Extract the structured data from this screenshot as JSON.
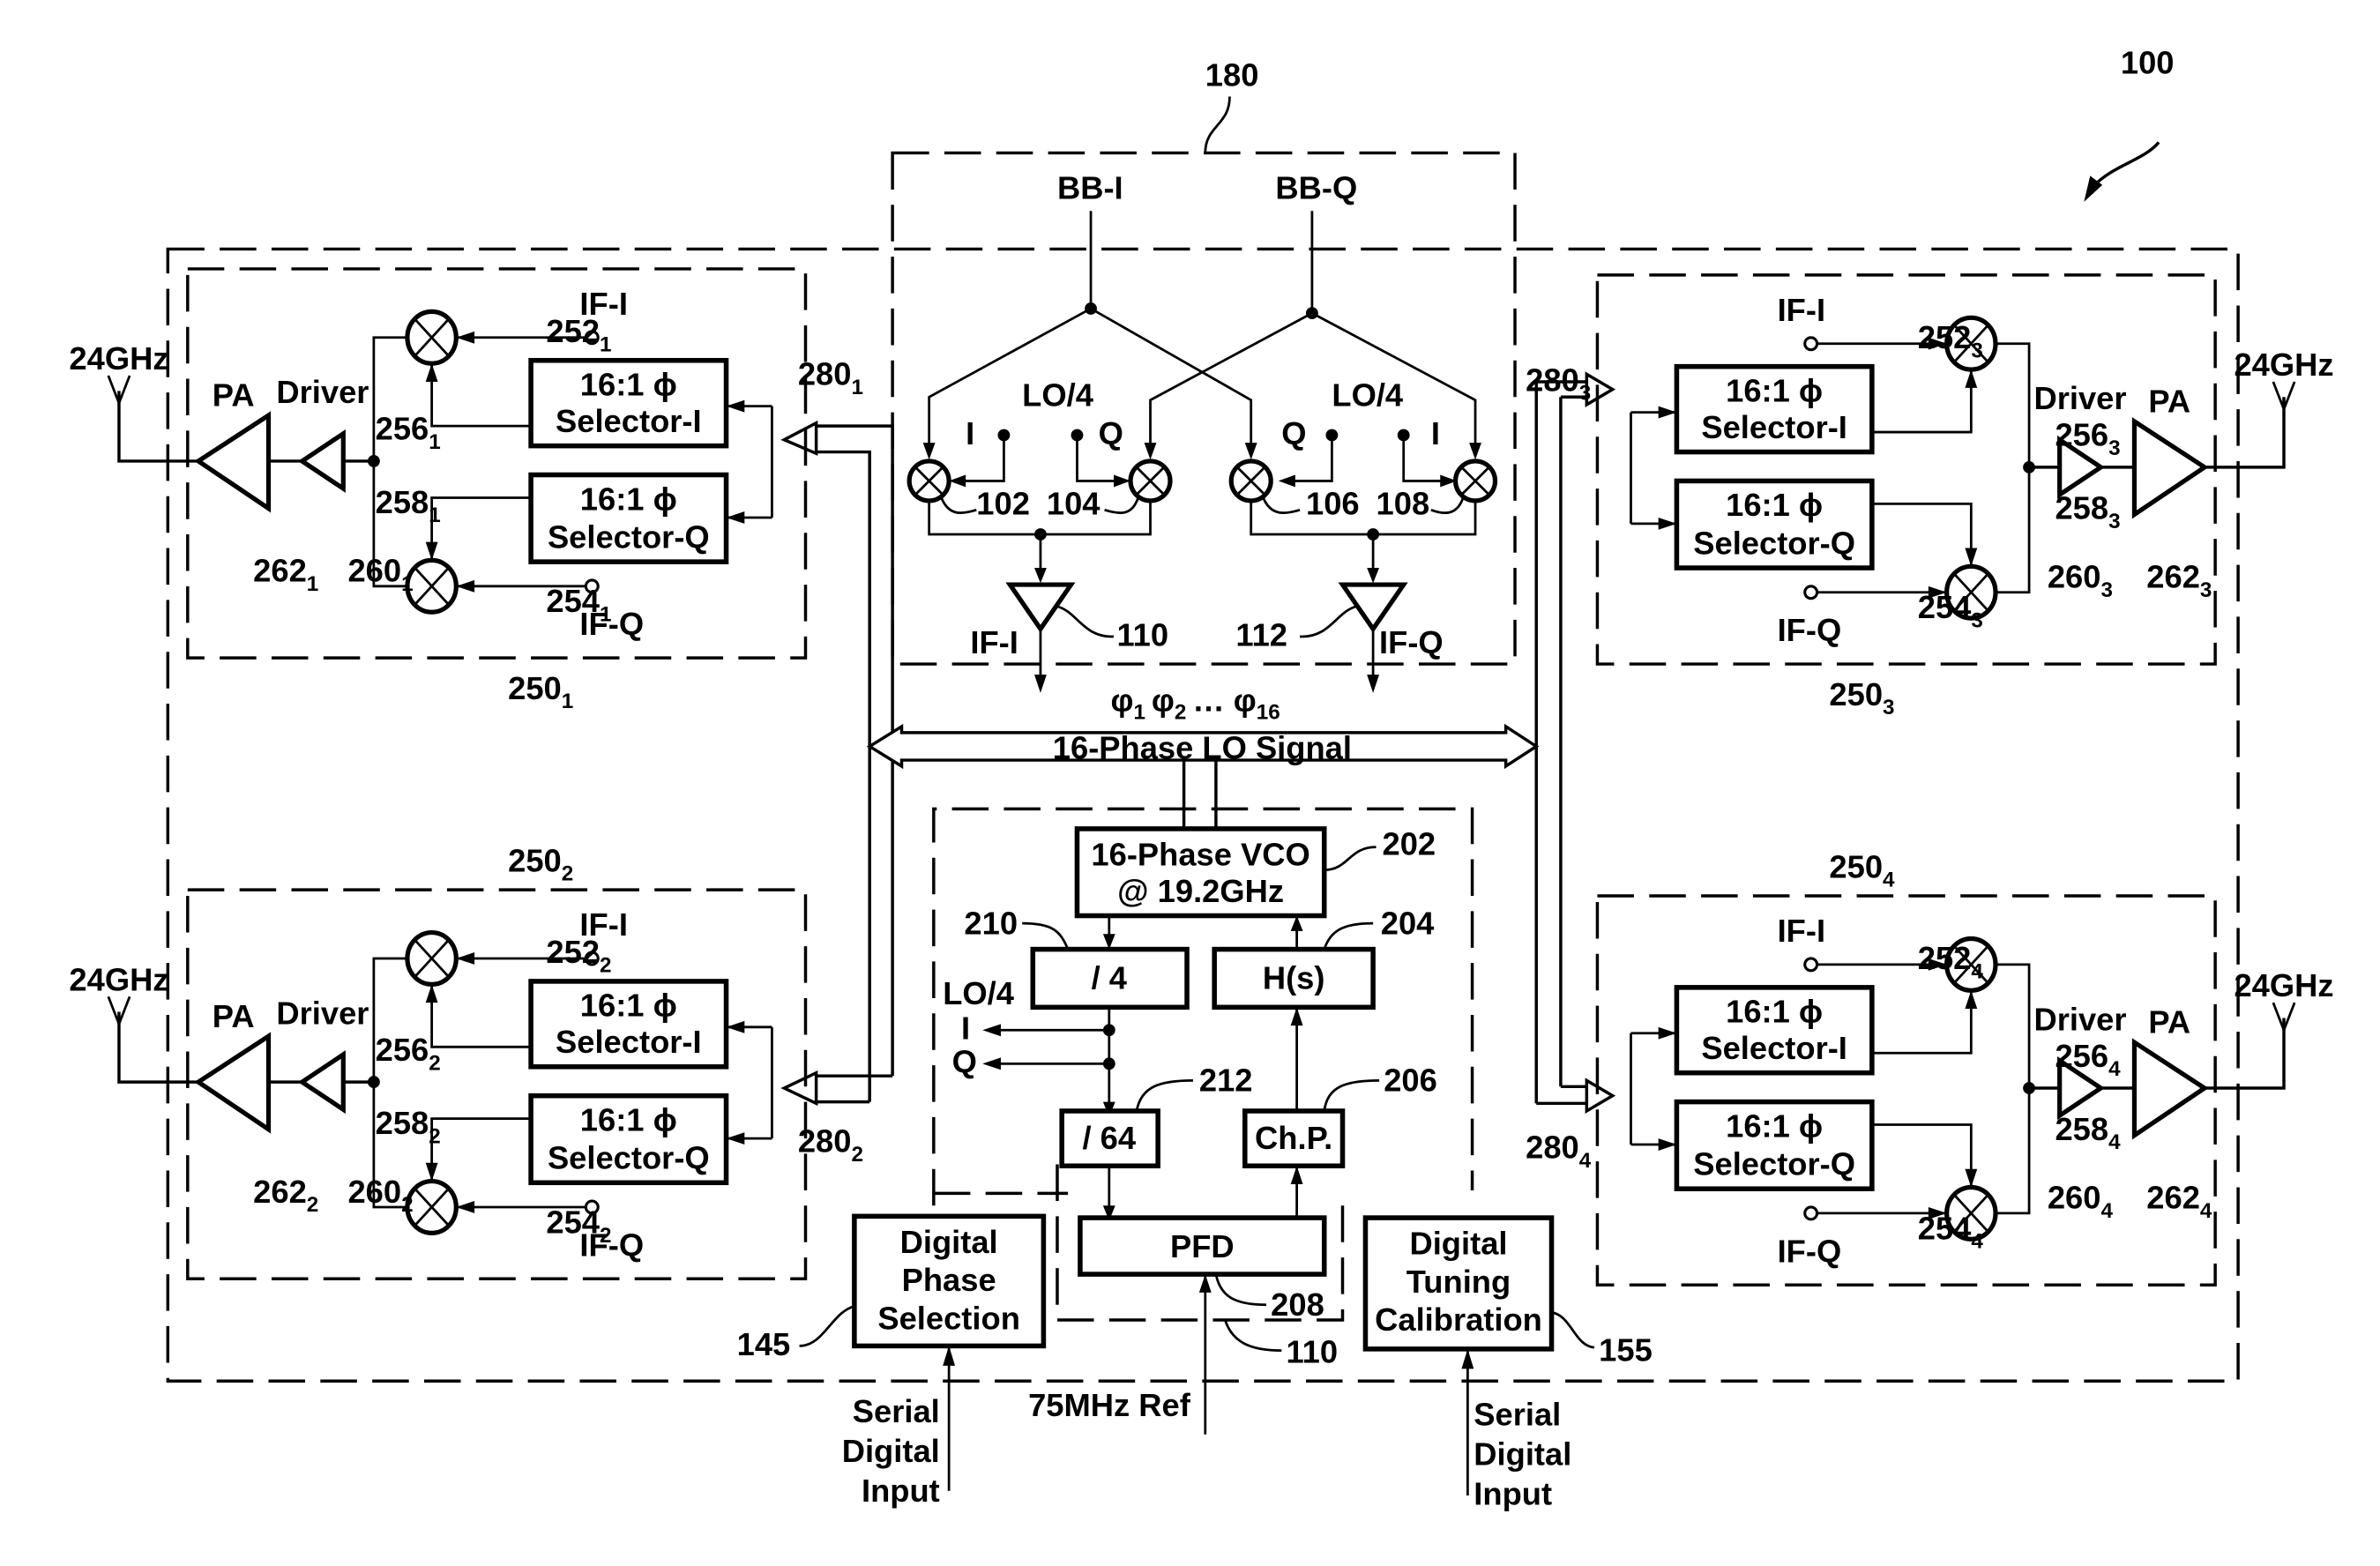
{
  "figure": {
    "ref_overall": "100",
    "ref_receiver": "180",
    "ref_synth": "110"
  },
  "receiver": {
    "bb_i": "BB-I",
    "bb_q": "BB-Q",
    "lo4_left": "LO/4",
    "lo4_right": "LO/4",
    "i_left": "I",
    "q_left": "Q",
    "q_right": "Q",
    "i_right": "I",
    "mixer_refs": [
      "102",
      "104",
      "106",
      "108"
    ],
    "if_i": "IF-I",
    "if_q": "IF-Q",
    "amp_i_ref": "110",
    "amp_q_ref": "112"
  },
  "lo_bus": {
    "phases": "φ1 φ2 … φ16",
    "phases_main": [
      "φ",
      "φ",
      "… φ"
    ],
    "phases_sub": [
      "1",
      "2",
      "16"
    ],
    "label": "16-Phase LO Signal"
  },
  "synth": {
    "vco_line1": "16-Phase VCO",
    "vco_line2": "@ 19.2GHz",
    "vco_ref": "202",
    "div4": "/ 4",
    "div4_ref": "210",
    "hs": "H(s)",
    "hs_ref": "204",
    "lo4": "LO/4",
    "out_i": "I",
    "out_q": "Q",
    "div64": "/ 64",
    "div64_ref": "212",
    "chp": "Ch.P.",
    "chp_ref": "206",
    "pfd": "PFD",
    "pfd_ref": "208",
    "ref_input": "75MHz Ref"
  },
  "phase_selection": {
    "lines": [
      "Digital",
      "Phase",
      "Selection"
    ],
    "ref": "145",
    "input_lines": [
      "Serial",
      "Digital",
      "Input"
    ]
  },
  "tuning_calibration": {
    "lines": [
      "Digital",
      "Tuning",
      "Calibration"
    ],
    "ref": "155",
    "input_lines": [
      "Serial",
      "Digital",
      "Input"
    ]
  },
  "transmitters": [
    {
      "id": "1",
      "block": "250",
      "sub": "1",
      "sel_i_ref": "252",
      "sel_q_ref": "254",
      "mix_i_ref": "256",
      "mix_q_ref": "258",
      "driver_ref": "260",
      "pa_ref": "262",
      "bus_ref": "280"
    },
    {
      "id": "2",
      "block": "250",
      "sub": "2",
      "sel_i_ref": "252",
      "sel_q_ref": "254",
      "mix_i_ref": "256",
      "mix_q_ref": "258",
      "driver_ref": "260",
      "pa_ref": "262",
      "bus_ref": "280"
    },
    {
      "id": "3",
      "block": "250",
      "sub": "3",
      "sel_i_ref": "252",
      "sel_q_ref": "254",
      "mix_i_ref": "256",
      "mix_q_ref": "258",
      "driver_ref": "260",
      "pa_ref": "262",
      "bus_ref": "280"
    },
    {
      "id": "4",
      "block": "250",
      "sub": "4",
      "sel_i_ref": "252",
      "sel_q_ref": "254",
      "mix_i_ref": "256",
      "mix_q_ref": "258",
      "driver_ref": "260",
      "pa_ref": "262",
      "bus_ref": "280"
    }
  ],
  "tx_labels": {
    "selector_top": "16:1 ϕ",
    "selector_i": "Selector-I",
    "selector_q": "Selector-Q",
    "if_i": "IF-I",
    "if_q": "IF-Q",
    "driver": "Driver",
    "pa": "PA",
    "freq": "24GHz"
  }
}
